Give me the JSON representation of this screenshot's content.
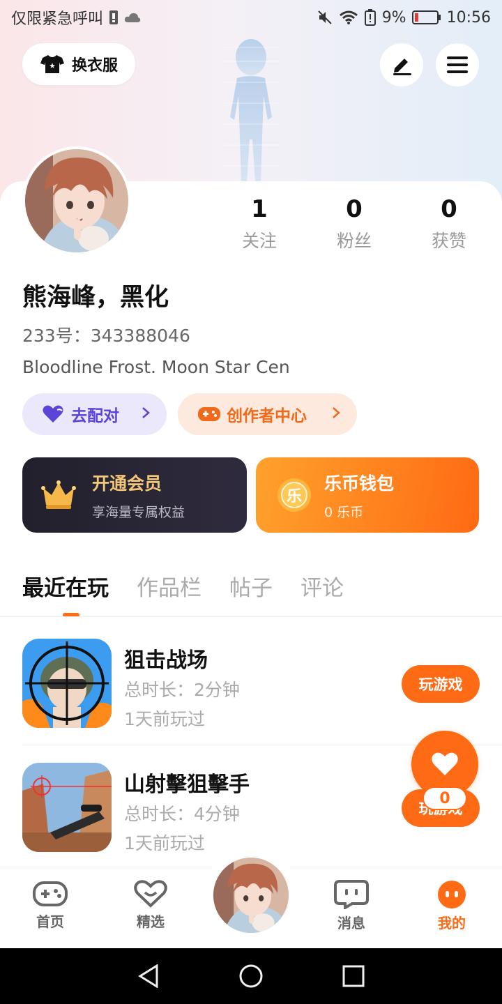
{
  "status_bar": {
    "carrier": "仅限紧急呼叫",
    "battery_percent": "9%",
    "time": "10:56"
  },
  "header": {
    "outfit_label": "换衣服"
  },
  "profile": {
    "stats": [
      {
        "value": "1",
        "label": "关注"
      },
      {
        "value": "0",
        "label": "粉丝"
      },
      {
        "value": "0",
        "label": "获赞"
      }
    ],
    "username": "熊海峰，黑化",
    "id_label": "233号：",
    "id_value": "343388046",
    "bio": "Bloodline Frost. Moon Star Cen",
    "match_label": "去配对",
    "creator_label": "创作者中心"
  },
  "vip": {
    "title": "开通会员",
    "subtitle": "享海量专属权益"
  },
  "wallet": {
    "title": "乐币钱包",
    "subtitle": "0 乐币",
    "coin_glyph": "乐"
  },
  "tabs": [
    "最近在玩",
    "作品栏",
    "帖子",
    "评论"
  ],
  "games": [
    {
      "name": "狙击战场",
      "duration": "总时长：2分钟",
      "last_played": "1天前玩过",
      "button": "玩游戏"
    },
    {
      "name": "山射擊狙擊手",
      "duration": "总时长：4分钟",
      "last_played": "1天前玩过",
      "button": "玩游戏"
    }
  ],
  "fab": {
    "count": "0"
  },
  "bottom_nav": [
    {
      "label": "首页"
    },
    {
      "label": "精选"
    },
    {
      "label": "消息"
    },
    {
      "label": "我的"
    }
  ],
  "colors": {
    "accent": "#ff6a14",
    "match": "#5b45d6",
    "vip_gold": "#f3c77a"
  }
}
